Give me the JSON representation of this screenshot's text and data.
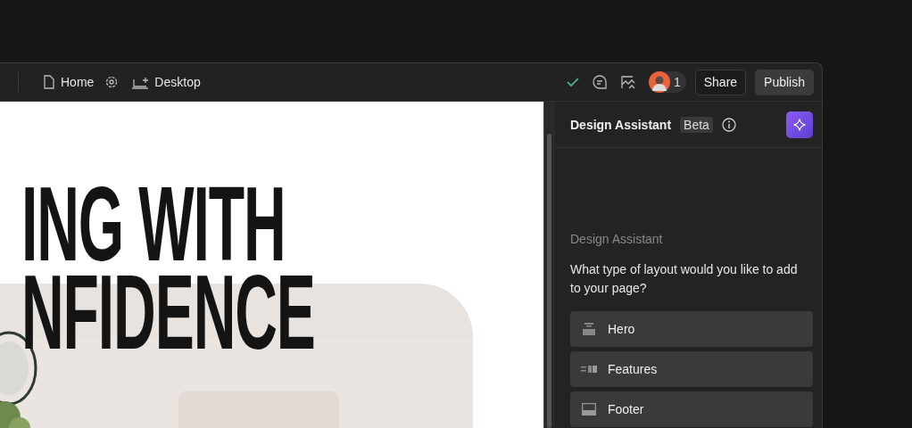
{
  "toolbar": {
    "page": "Home",
    "device": "Desktop",
    "collaborator_count": "1",
    "share": "Share",
    "publish": "Publish"
  },
  "canvas": {
    "headline": [
      "ING WITH",
      "NFIDENCE"
    ],
    "image": {
      "kind": "picture"
    }
  },
  "assistant": {
    "title": "Design Assistant",
    "badge": "Beta",
    "section_label": "Design Assistant",
    "question": "What type of layout would you like to add to your page?",
    "options": [
      {
        "kind": "hero",
        "label": "Hero"
      },
      {
        "kind": "features",
        "label": "Features"
      },
      {
        "kind": "footer",
        "label": "Footer"
      }
    ]
  }
}
